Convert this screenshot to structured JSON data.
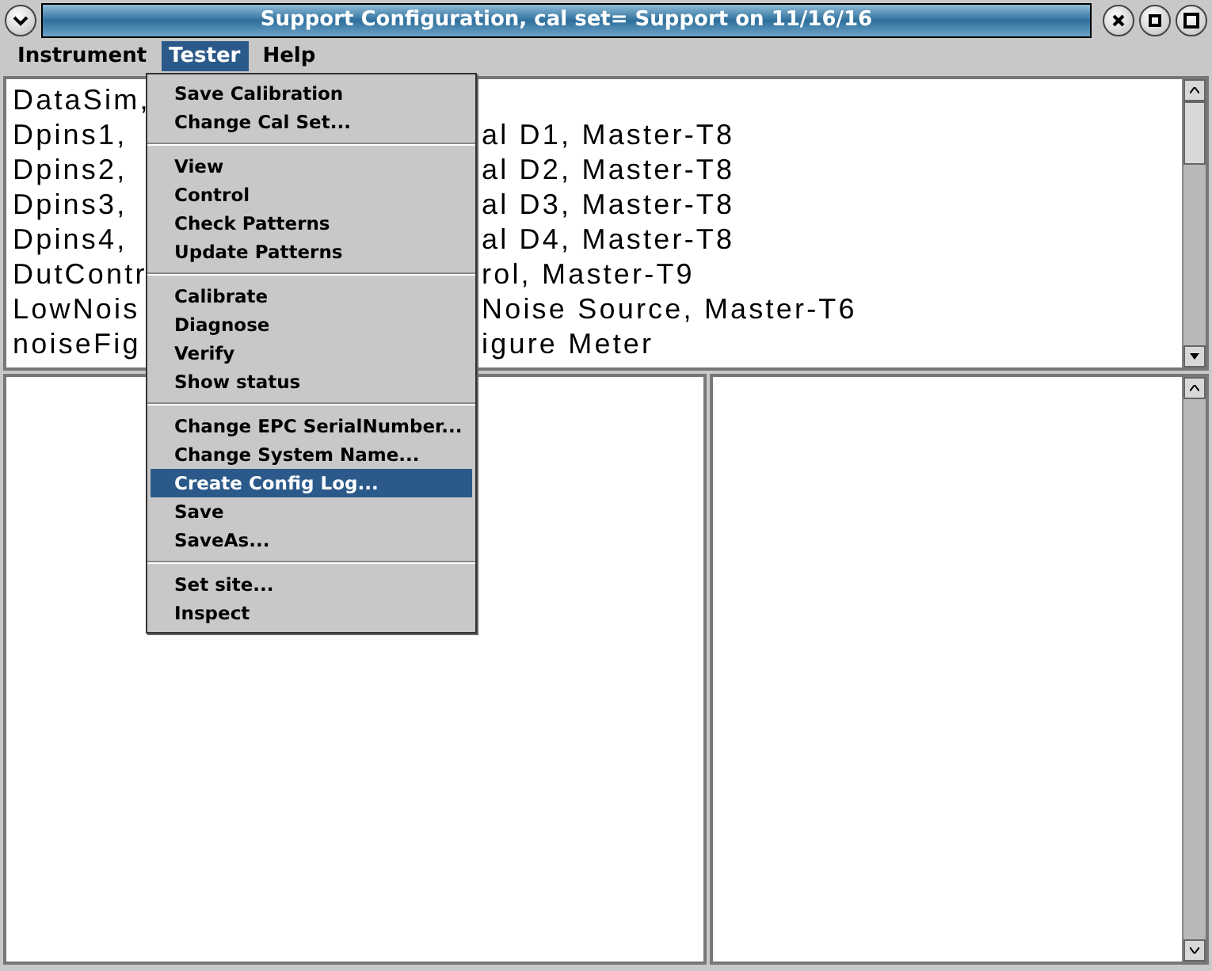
{
  "window": {
    "title": "Support Configuration,  cal set= Support on 11/16/16"
  },
  "menubar": [
    {
      "label": "Instrument",
      "selected": false
    },
    {
      "label": "Tester",
      "selected": true
    },
    {
      "label": "Help",
      "selected": false
    }
  ],
  "list": {
    "rows": [
      {
        "start": "DataSim,",
        "end": ""
      },
      {
        "start": "Dpins1,",
        "end": "al D1, Master-T8"
      },
      {
        "start": "Dpins2,",
        "end": "al D2, Master-T8"
      },
      {
        "start": "Dpins3,",
        "end": "al D3, Master-T8"
      },
      {
        "start": "Dpins4,",
        "end": "al D4, Master-T8"
      },
      {
        "start": "DutContr",
        "end": "rol, Master-T9"
      },
      {
        "start": "LowNois",
        "end": "Noise Source, Master-T6"
      },
      {
        "start": "noiseFig",
        "end": "igure Meter"
      }
    ]
  },
  "menu": {
    "sections": [
      [
        {
          "label": "Save Calibration",
          "selected": false
        },
        {
          "label": "Change Cal Set...",
          "selected": false
        }
      ],
      [
        {
          "label": "View",
          "selected": false
        },
        {
          "label": "Control",
          "selected": false
        },
        {
          "label": "Check Patterns",
          "selected": false
        },
        {
          "label": "Update Patterns",
          "selected": false
        }
      ],
      [
        {
          "label": "Calibrate",
          "selected": false
        },
        {
          "label": "Diagnose",
          "selected": false
        },
        {
          "label": "Verify",
          "selected": false
        },
        {
          "label": "Show status",
          "selected": false
        }
      ],
      [
        {
          "label": "Change EPC SerialNumber...",
          "selected": false
        },
        {
          "label": "Change System Name...",
          "selected": false
        },
        {
          "label": "Create Config Log...",
          "selected": true
        },
        {
          "label": "Save",
          "selected": false
        },
        {
          "label": "SaveAs...",
          "selected": false
        }
      ],
      [
        {
          "label": "Set site...",
          "selected": false
        },
        {
          "label": "Inspect",
          "selected": false
        }
      ]
    ]
  }
}
